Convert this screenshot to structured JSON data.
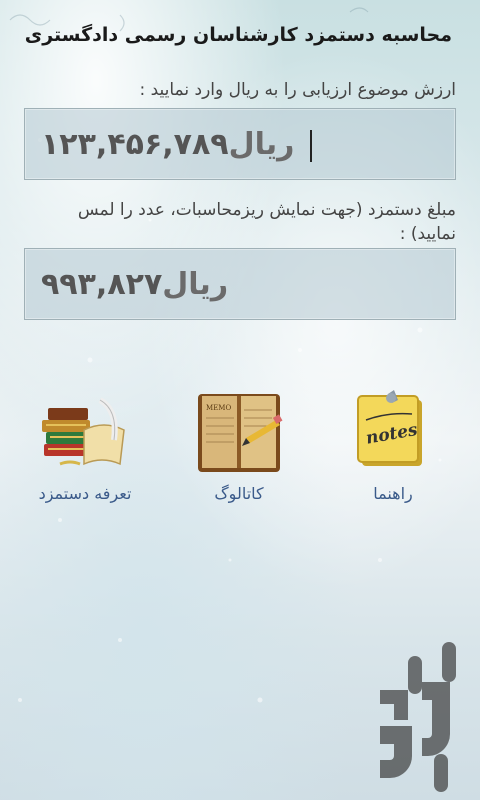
{
  "app": {
    "title": "محاسبه دستمزد کارشناسان رسمی دادگستری"
  },
  "input_section": {
    "label": "ارزش موضوع ارزیابی را به ریال وارد نمایید :",
    "amount": "۱۲۳,۴۵۶,۷۸۹",
    "unit": "ریال"
  },
  "result_section": {
    "label": "مبلغ دستمزد (جهت نمایش ریزمحاسبات، عدد را لمس نمایید) :",
    "amount": "۹۹۳,۸۲۷",
    "unit": "ریال"
  },
  "menu": {
    "guide": {
      "label": "راهنما",
      "icon": "notes-icon",
      "icon_text": "notes"
    },
    "catalog": {
      "label": "کاتالوگ",
      "icon": "memo-book-icon",
      "icon_text": "MEMO"
    },
    "tariff": {
      "label": "تعرفه دستمزد",
      "icon": "books-scroll-icon"
    }
  },
  "colors": {
    "caption": "#3a5a8a",
    "field_bg": "#b4c8d2",
    "amount_text": "#555555"
  }
}
